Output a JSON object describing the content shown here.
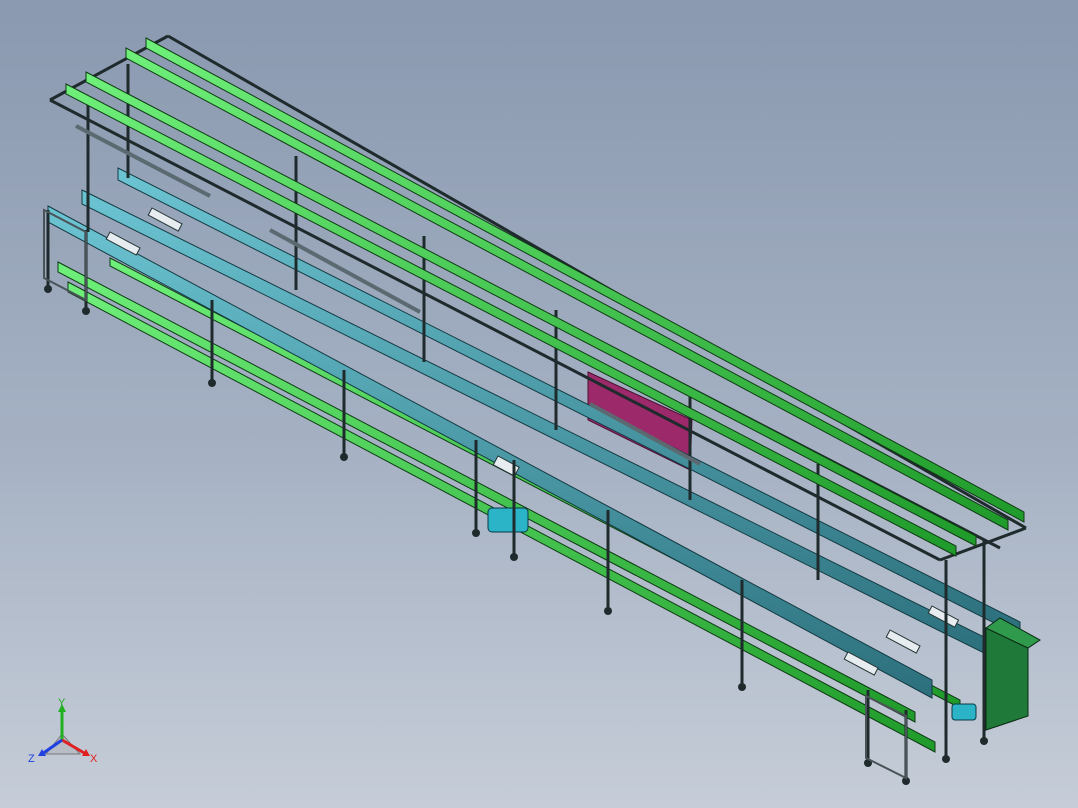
{
  "view": {
    "background_top": "#8a99b0",
    "background_bottom": "#c6cdd8",
    "model": {
      "frame_color": "#1f2a2c",
      "rail_color": "#3ee04a",
      "conveyor_color": "#4a9fae",
      "motor_color": "#2bb3c8",
      "cabinet_color": "#1f7a3a",
      "panel_color": "#9c2a6a"
    }
  },
  "triad": {
    "x_label": "X",
    "y_label": "Y",
    "z_label": "Z",
    "x_color": "#e02020",
    "y_color": "#20b020",
    "z_color": "#2040e0"
  }
}
